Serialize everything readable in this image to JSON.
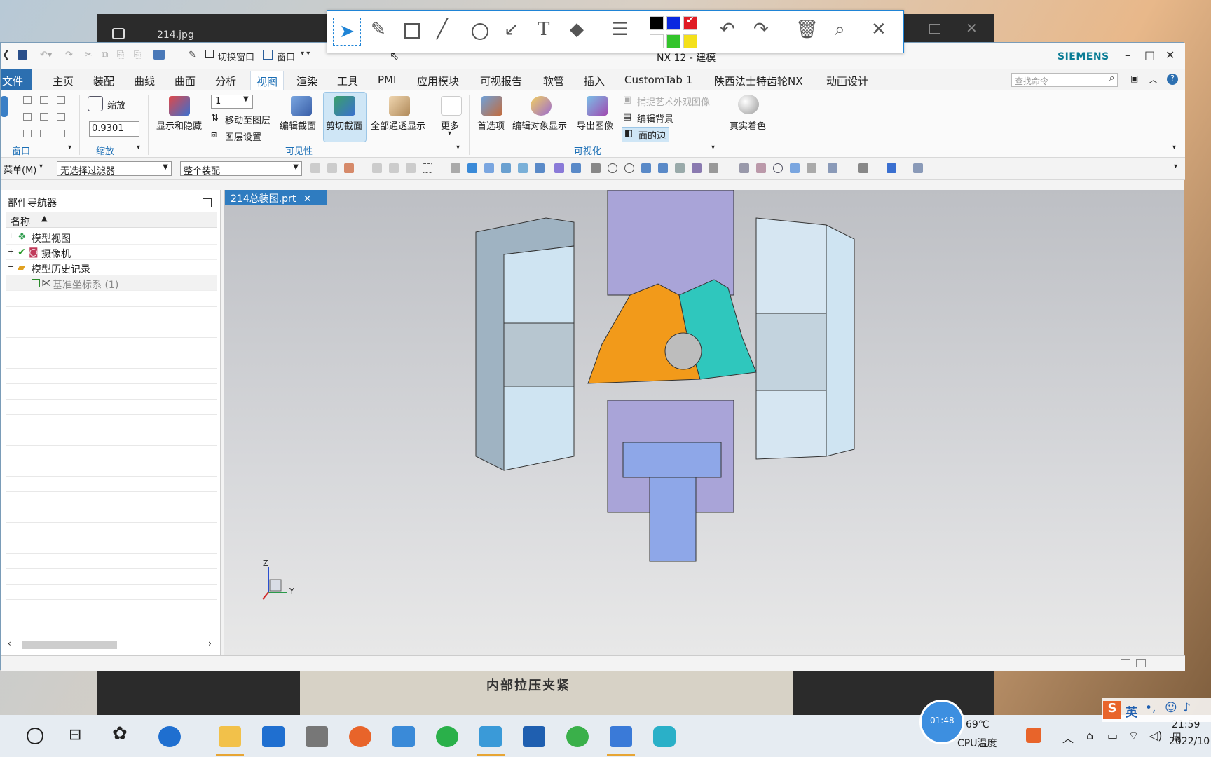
{
  "photo_viewer": {
    "title": "214.jpg",
    "paper_text": "内部拉压夹紧",
    "timer": "01:48"
  },
  "nx": {
    "window_title": "NX 12 - 建模",
    "brand": "SIEMENS",
    "menu": [
      "文件(F)",
      "主页",
      "装配",
      "曲线",
      "曲面",
      "分析",
      "视图",
      "渲染",
      "工具",
      "PMI",
      "应用模块",
      "可视报告",
      "软管",
      "插入",
      "CustomTab 1",
      "陕西法士特齿轮NX",
      "动画设计"
    ],
    "search_placeholder": "查找命令",
    "quick": {
      "switch_window": "切换窗口",
      "window": "窗口"
    },
    "ribbon": {
      "zoom_label": "缩放",
      "zoom_value": "0.9301",
      "layer_value": "1",
      "show_hide": "显示和隐藏",
      "move_to_layer": "移动至图层",
      "layer_settings": "图层设置",
      "edit_section": "编辑截面",
      "clip_section": "剪切截面",
      "all_transparent": "全部通透显示",
      "more": "更多",
      "preferences": "首选项",
      "edit_object_display": "编辑对象显示",
      "export_image": "导出图像",
      "capture_art": "捕捉艺术外观图像",
      "edit_background": "编辑背景",
      "face_edges": "面的边",
      "true_shading": "真实着色",
      "groups": {
        "window": "窗口",
        "zoom": "缩放",
        "visibility": "可见性",
        "visualization": "可视化"
      }
    },
    "filter": {
      "menu": "菜单(M)",
      "selection_filter": "无选择过滤器",
      "scope": "整个装配"
    },
    "navigator": {
      "title": "部件导航器",
      "column": "名称",
      "items": [
        "模型视图",
        "摄像机",
        "模型历史记录",
        "基准坐标系 (1)"
      ]
    },
    "doc_tab": "214总装图.prt",
    "triad": {
      "z": "Z",
      "y": "Y"
    }
  },
  "annotation": {
    "colors": [
      "#000000",
      "#0a28e0",
      "#e01b24",
      "#ffffff",
      "#33c42b",
      "#f4e01a"
    ]
  },
  "taskbar": {
    "cpu_temp": "69℃",
    "cpu_label": "CPU温度",
    "time": "21:59 周",
    "date": "2022/10"
  },
  "ime": {
    "lang": "英"
  }
}
